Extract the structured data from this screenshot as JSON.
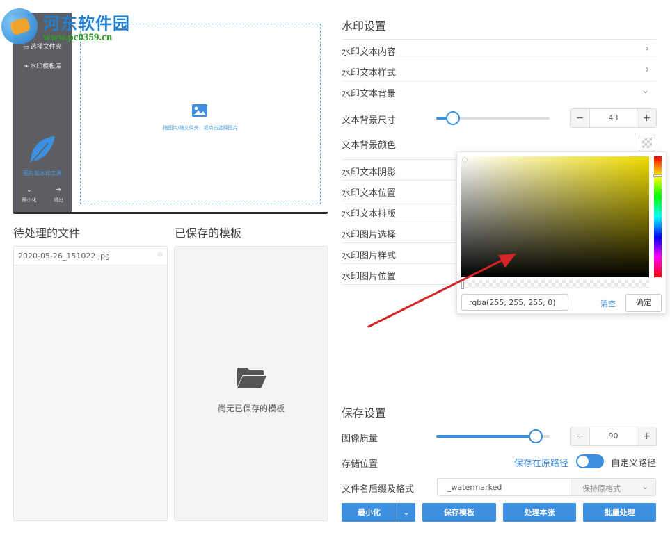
{
  "watermark": {
    "title": "河东软件园",
    "url": "www.pc0359.cn"
  },
  "preview": {
    "sidebar": {
      "items": [
        {
          "label": "选择文件夹",
          "icon": "folder-icon"
        },
        {
          "label": "水印模板库",
          "icon": "leaf-icon"
        }
      ],
      "app_name": "图片加水印工具",
      "minimize_label": "最小化",
      "exit_label": "退出"
    },
    "dropzone_text": "拖图片/拖文件夹，或点击选择图片"
  },
  "pending": {
    "heading": "待处理的文件",
    "files": [
      "2020-05-26_151022.jpg"
    ]
  },
  "templates": {
    "heading": "已保存的模板",
    "empty_text": "尚无已保存的模板"
  },
  "watermark_settings": {
    "heading": "水印设置",
    "rows_top": [
      "水印文本内容",
      "水印文本样式",
      "水印文本背景"
    ],
    "bg_size_label": "文本背景尺寸",
    "bg_size_value": "43",
    "bg_size_fraction": 0.15,
    "bg_color_label": "文本背景颜色",
    "rows_bottom": [
      "水印文本阴影",
      "水印文本位置",
      "水印文本排版",
      "水印图片选择",
      "水印图片样式",
      "水印图片位置"
    ]
  },
  "color_picker": {
    "value": "rgba(255, 255, 255, 0)",
    "clear_label": "清空",
    "ok_label": "确定"
  },
  "save_settings": {
    "heading": "保存设置",
    "quality_label": "图像质量",
    "quality_value": "90",
    "quality_fraction": 0.88,
    "location_label": "存储位置",
    "original_path_label": "保存在原路径",
    "custom_path_label": "自定义路径",
    "suffix_label": "文件名后缀及格式",
    "suffix_value": "_watermarked",
    "format_value": "保持原格式"
  },
  "buttons": {
    "minimize": "最小化",
    "save_template": "保存模板",
    "process_one": "处理本张",
    "batch_process": "批量处理"
  },
  "colors": {
    "accent": "#3d8fe0",
    "arrow": "#d42424"
  }
}
